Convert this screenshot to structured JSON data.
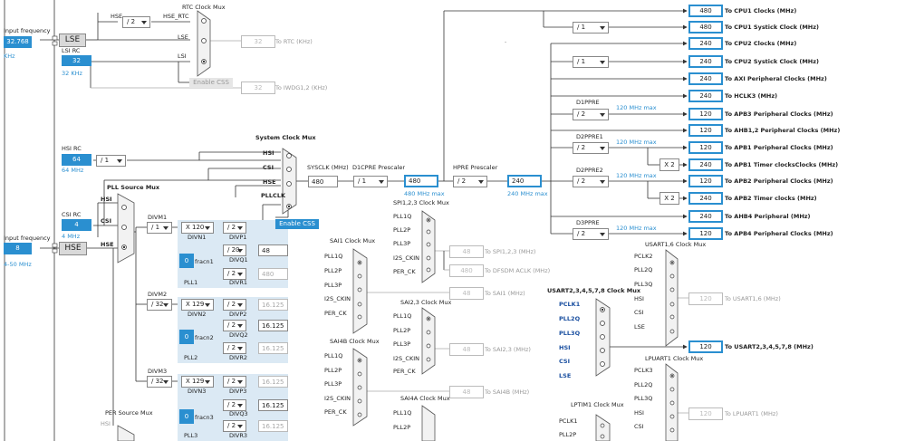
{
  "left": {
    "input_freq_label": "Input frequency",
    "lse_freq": "32.768",
    "lse_unit": "KHz",
    "lse_label": "LSE",
    "lsirc_label": "LSI RC",
    "lsi_freq": "32",
    "lsi_unit": "32 KHz",
    "hsirc_label": "HSI RC",
    "hsi_freq": "64",
    "hsi_unit": "64 MHz",
    "hsi_div": "/ 1",
    "csirc_label": "CSI RC",
    "csi_freq": "4",
    "csi_unit": "4 MHz",
    "input_freq2_label": "Input frequency",
    "hse_freq": "8",
    "hse_unit": "4-50 MHz",
    "hse_label": "HSE"
  },
  "rtc": {
    "title": "RTC Clock Mux",
    "hse": "HSE",
    "div": "/ 2",
    "hse_rtc": "HSE_RTC",
    "lse": "LSE",
    "lsi": "LSI",
    "out": "32",
    "out_label": "To RTC (KHz)",
    "enable_css": "Enable CSS",
    "iwdg_out": "32",
    "iwdg_label": "To IWDG1,2 (KHz)"
  },
  "pll": {
    "source_mux": "PLL Source Mux",
    "hsi": "HSI",
    "csi": "CSI",
    "hse": "HSE",
    "divm1": "DIVM1",
    "divm1_val": "/ 1",
    "divn1_val": "X 120",
    "divn1": "DIVN1",
    "divp1_val": "/ 2",
    "divp1": "DIVP1",
    "divq1_val": "/ 20",
    "divq1": "DIVQ1",
    "q1_out": "48",
    "fracn1_val": "0",
    "fracn1": "fracn1",
    "divr1_val": "/ 2",
    "divr1": "DIVR1",
    "r1_out": "480",
    "pll1": "PLL1",
    "divm2": "DIVM2",
    "divm2_val": "/ 32",
    "divn2_val": "X 129",
    "divn2": "DIVN2",
    "divp2_val": "/ 2",
    "divp2": "DIVP2",
    "p2_out": "16.125",
    "divq2_val": "/ 2",
    "divq2": "DIVQ2",
    "q2_out": "16.125",
    "fracn2_val": "0",
    "fracn2": "fracn2",
    "divr2_val": "/ 2",
    "divr2": "DIVR2",
    "r2_out": "16.125",
    "pll2": "PLL2",
    "divm3": "DIVM3",
    "divm3_val": "/ 32",
    "divn3_val": "X 129",
    "divn3": "DIVN3",
    "divp3_val": "/ 2",
    "divp3": "DIVP3",
    "p3_out": "16.125",
    "divq3_val": "/ 2",
    "divq3": "DIVQ3",
    "q3_out": "16.125",
    "fracn3_val": "0",
    "fracn3": "fracn3",
    "divr3_val": "/ 2",
    "divr3": "DIVR3",
    "r3_out": "16.125",
    "pll3": "PLL3",
    "per_mux": "PER Source Mux",
    "per_hsi": "HSI"
  },
  "sys": {
    "mux_title": "System Clock Mux",
    "hsi": "HSI",
    "csi": "CSI",
    "hse": "HSE",
    "pllclk": "PLLCLK",
    "enable_css": "Enable CSS",
    "sysclk_label": "SYSCLK (MHz)",
    "sysclk": "480",
    "d1cpre_label": "D1CPRE Prescaler",
    "d1cpre": "/ 1",
    "d1_out": "480",
    "d1_max": "480 MHz max",
    "hpre_label": "HPRE Prescaler",
    "hpre": "/ 2",
    "hpre_out": "240",
    "hpre_max": "240 MHz max",
    "div1": "/ 1",
    "div2": "/ 1",
    "dot": "."
  },
  "outputs": [
    {
      "val": "480",
      "label": "To CPU1 Clocks (MHz)"
    },
    {
      "val": "480",
      "label": "To CPU1 Systick Clock (MHz)"
    },
    {
      "val": "240",
      "label": "To CPU2 Clocks (MHz)"
    },
    {
      "val": "240",
      "label": "To CPU2 Systick Clock (MHz)"
    },
    {
      "val": "240",
      "label": "To AXI Peripheral Clocks (MHz)"
    },
    {
      "val": "240",
      "label": "To HCLK3 (MHz)"
    },
    {
      "val": "120",
      "label": "To APB3 Peripheral Clocks (MHz)"
    },
    {
      "val": "120",
      "label": "To AHB1,2 Peripheral Clocks (MHz)"
    },
    {
      "val": "120",
      "label": "To APB1 Peripheral Clocks (MHz)"
    },
    {
      "val": "240",
      "label": "To APB1 Timer clocksClocks (MHz)"
    },
    {
      "val": "120",
      "label": "To APB2 Peripheral Clocks (MHz)"
    },
    {
      "val": "240",
      "label": "To APB2 Timer clocks (MHz)"
    },
    {
      "val": "240",
      "label": "To AHB4 Peripheral (MHz)"
    },
    {
      "val": "120",
      "label": "To APB4 Peripheral Clocks (MHz)"
    }
  ],
  "pre": {
    "d1ppre": "D1PPRE",
    "d1ppre_val": "/ 2",
    "d1ppre_max": "120 MHz max",
    "d2ppre1": "D2PPRE1",
    "d2ppre1_val": "/ 2",
    "d2ppre1_max": "120 MHz max",
    "x2a": "X 2",
    "d2ppre2": "D2PPRE2",
    "d2ppre2_val": "/ 2",
    "d2ppre2_max": "120 MHz max",
    "x2b": "X 2",
    "d3ppre": "D3PPRE",
    "d3ppre_val": "/ 2",
    "d3ppre_max": "120 MHz max"
  },
  "periph": {
    "spi123_title": "SPI1,2,3 Clock Mux",
    "spi_in": [
      "PLL1Q",
      "PLL2P",
      "PLL3P",
      "I2S_CKIN",
      "PER_CK"
    ],
    "spi_out": "48",
    "spi_label": "To SPI1,2,3 (MHz)",
    "dfsdm_out": "480",
    "dfsdm_label": "To DFSDM ACLK (MHz)",
    "sai1_title": "SAI1 Clock Mux",
    "sai1_in": [
      "PLL1Q",
      "PLL2P",
      "PLL3P",
      "I2S_CKIN",
      "PER_CK"
    ],
    "sai1_out": "48",
    "sai1_label": "To SAI1 (MHz)",
    "sai23_title": "SAI2,3 Clock Mux",
    "sai23_in": [
      "PLL1Q",
      "PLL2P",
      "PLL3P",
      "I2S_CKIN",
      "PER_CK"
    ],
    "sai23_out": "48",
    "sai23_label": "To SAI2,3 (MHz)",
    "sai4b_title": "SAI4B Clock Mux",
    "sai4b_in": [
      "PLL1Q",
      "PLL2P",
      "PLL3P",
      "I2S_CKIN",
      "PER_CK"
    ],
    "sai4a_title": "SAI4A Clock Mux",
    "sai4a_in": [
      "PLL1Q",
      "PLL2P"
    ],
    "sai4b_out": "48",
    "sai4b_label": "To SAI4B (MHz)",
    "usart16_title": "USART1,6 Clock Mux",
    "usart16_in": [
      "PCLK2",
      "PLL2Q",
      "PLL3Q",
      "HSI",
      "CSI",
      "LSE"
    ],
    "usart16_out": "120",
    "usart16_label": "To USART1,6 (MHz)",
    "usart2_title": "USART2,3,4,5,7,8 Clock Mux",
    "usart2_in": [
      "PCLK1",
      "PLL2Q",
      "PLL3Q",
      "HSI",
      "CSI",
      "LSE"
    ],
    "usart2_out": "120",
    "usart2_label": "To USART2,3,4,5,7,8 (MHz)",
    "lpuart_title": "LPUART1 Clock Mux",
    "lpuart_in": [
      "PCLK3",
      "PLL2Q",
      "PLL3Q",
      "HSI",
      "CSI"
    ],
    "lpuart_out": "120",
    "lpuart_label": "To LPUART1 (MHz)",
    "lptim_title": "LPTIM1 Clock Mux",
    "lptim_in": [
      "PCLK1",
      "PLL2P"
    ]
  },
  "colors": {
    "accent": "#2a8fd0",
    "pll_bg": "#dbe9f4",
    "mux_fill": "#f2f2f2",
    "wire": "#333333",
    "disabled": "#aaaaaa"
  }
}
